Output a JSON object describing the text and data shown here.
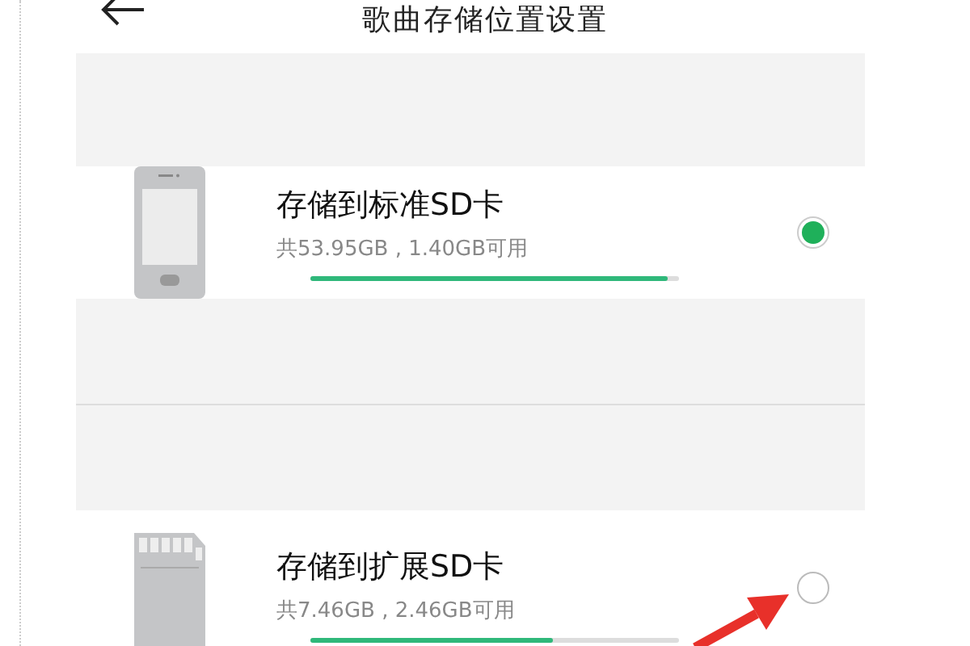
{
  "header": {
    "title": "歌曲存储位置设置"
  },
  "options": [
    {
      "kind": "phone",
      "title": "存储到标准SD卡",
      "subtitle": "共53.95GB , 1.40GB可用",
      "level": 0.97,
      "selected": true
    },
    {
      "kind": "sdcard",
      "title": "存储到扩展SD卡",
      "subtitle": "共7.46GB , 2.46GB可用",
      "level": 0.66,
      "selected": false
    }
  ]
}
